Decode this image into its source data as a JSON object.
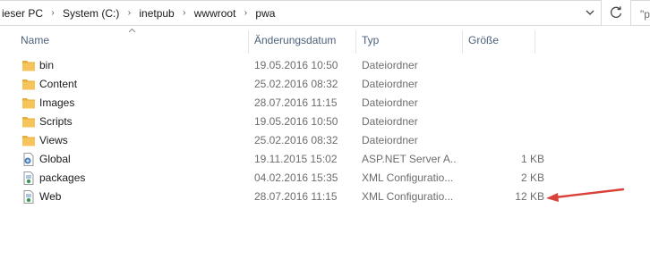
{
  "address": {
    "crumbs": [
      "ieser PC",
      "System (C:)",
      "inetpub",
      "wwwroot",
      "pwa"
    ],
    "search_placeholder": "\"p"
  },
  "columns": {
    "name": "Name",
    "date": "Änderungsdatum",
    "type": "Typ",
    "size": "Größe"
  },
  "files": [
    {
      "name": "bin",
      "date": "19.05.2016 10:50",
      "type": "Dateiordner",
      "size": "",
      "icon": "folder-icon"
    },
    {
      "name": "Content",
      "date": "25.02.2016 08:32",
      "type": "Dateiordner",
      "size": "",
      "icon": "folder-icon"
    },
    {
      "name": "Images",
      "date": "28.07.2016 11:15",
      "type": "Dateiordner",
      "size": "",
      "icon": "folder-icon"
    },
    {
      "name": "Scripts",
      "date": "19.05.2016 10:50",
      "type": "Dateiordner",
      "size": "",
      "icon": "folder-icon"
    },
    {
      "name": "Views",
      "date": "25.02.2016 08:32",
      "type": "Dateiordner",
      "size": "",
      "icon": "folder-icon"
    },
    {
      "name": "Global",
      "date": "19.11.2015 15:02",
      "type": "ASP.NET Server A...",
      "size": "1 KB",
      "icon": "aspnet-file-icon"
    },
    {
      "name": "packages",
      "date": "04.02.2016 15:35",
      "type": "XML Configuratio...",
      "size": "2 KB",
      "icon": "xml-config-file-icon"
    },
    {
      "name": "Web",
      "date": "28.07.2016 11:15",
      "type": "XML Configuratio...",
      "size": "12 KB",
      "icon": "xml-config-file-icon"
    }
  ],
  "colors": {
    "header_text": "#4c607a",
    "folder": "#f5c45a",
    "annotation_arrow": "#d9413a"
  }
}
